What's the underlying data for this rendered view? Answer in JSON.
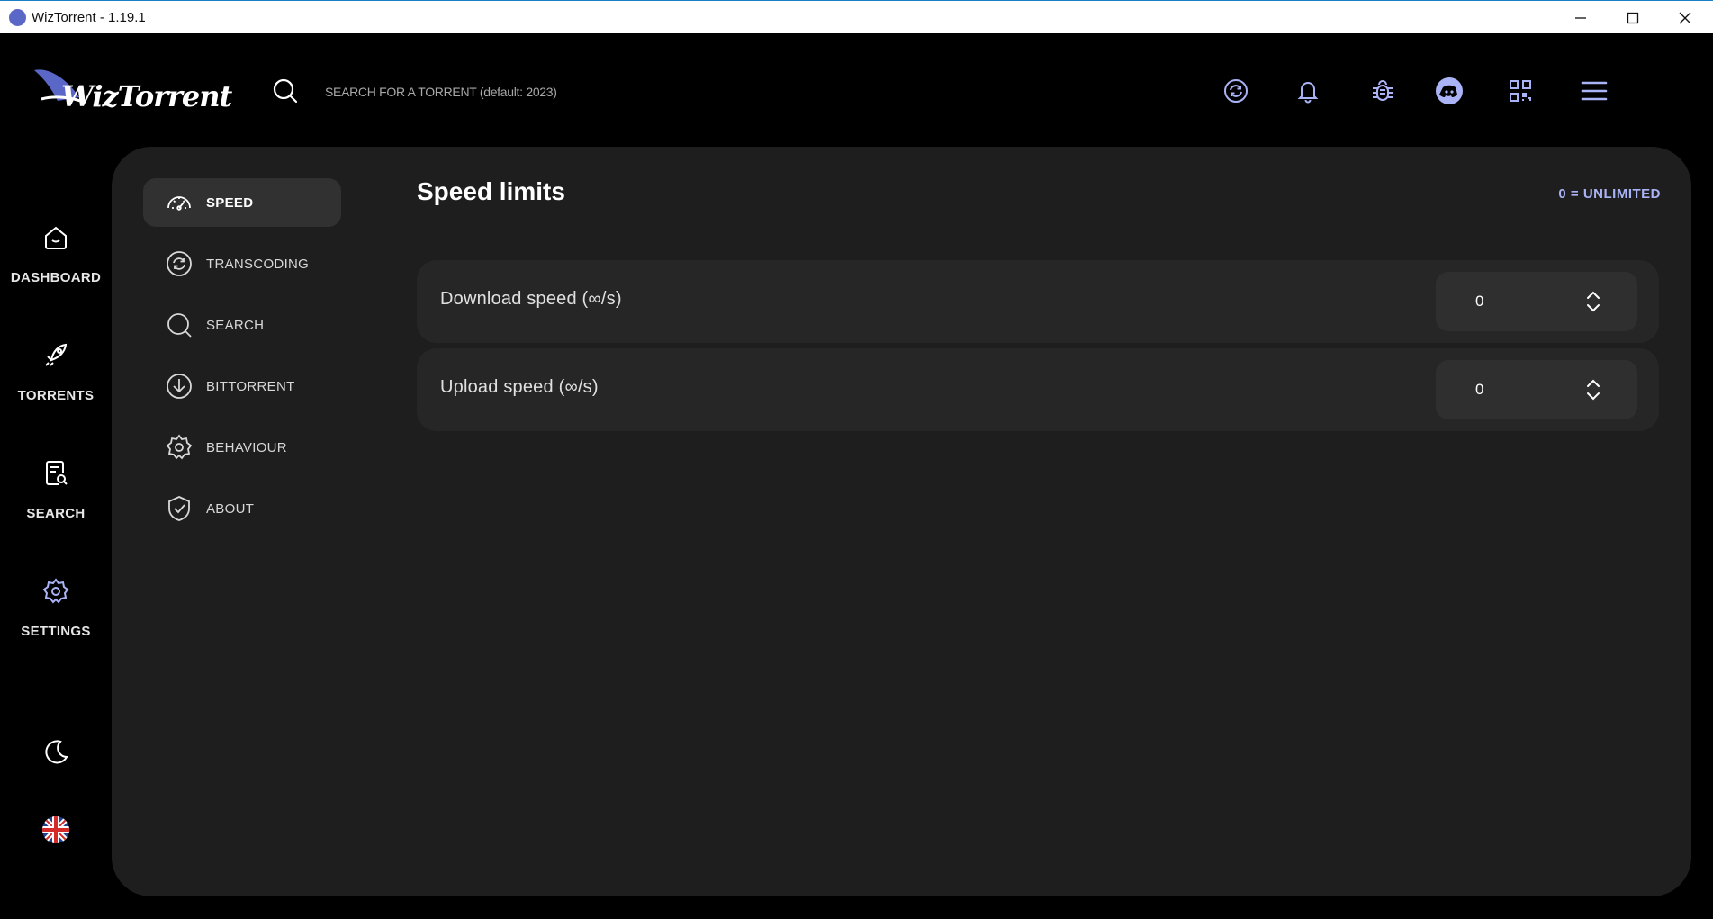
{
  "window": {
    "title": "WizTorrent - 1.19.1"
  },
  "header": {
    "logo_text": "WizTorrent",
    "search_placeholder": "SEARCH FOR A TORRENT (default: 2023)",
    "icons": [
      "sync-icon",
      "bell-icon",
      "bug-icon",
      "discord-icon",
      "qr-code-icon",
      "menu-icon"
    ]
  },
  "rail": {
    "items": [
      {
        "label": "DASHBOARD",
        "icon": "home-icon"
      },
      {
        "label": "TORRENTS",
        "icon": "rocket-icon"
      },
      {
        "label": "SEARCH",
        "icon": "search-document-icon"
      },
      {
        "label": "SETTINGS",
        "icon": "gear-icon",
        "active": true
      }
    ],
    "bottom_icons": [
      "moon-icon",
      "uk-flag-icon"
    ]
  },
  "settings_nav": {
    "items": [
      {
        "label": "SPEED",
        "icon": "speedometer-icon",
        "active": true
      },
      {
        "label": "TRANSCODING",
        "icon": "sync-icon"
      },
      {
        "label": "SEARCH",
        "icon": "search-icon"
      },
      {
        "label": "BITTORRENT",
        "icon": "download-circle-icon"
      },
      {
        "label": "BEHAVIOUR",
        "icon": "gear-icon"
      },
      {
        "label": "ABOUT",
        "icon": "shield-check-icon"
      }
    ]
  },
  "speed": {
    "title": "Speed limits",
    "note": "0 = UNLIMITED",
    "rows": [
      {
        "label": "Download speed (∞/s)",
        "value": "0"
      },
      {
        "label": "Upload speed (∞/s)",
        "value": "0"
      }
    ]
  },
  "colors": {
    "accent": "#aab3f5",
    "panel": "#1e1e1e",
    "row": "#262626",
    "active_nav": "#313131"
  }
}
